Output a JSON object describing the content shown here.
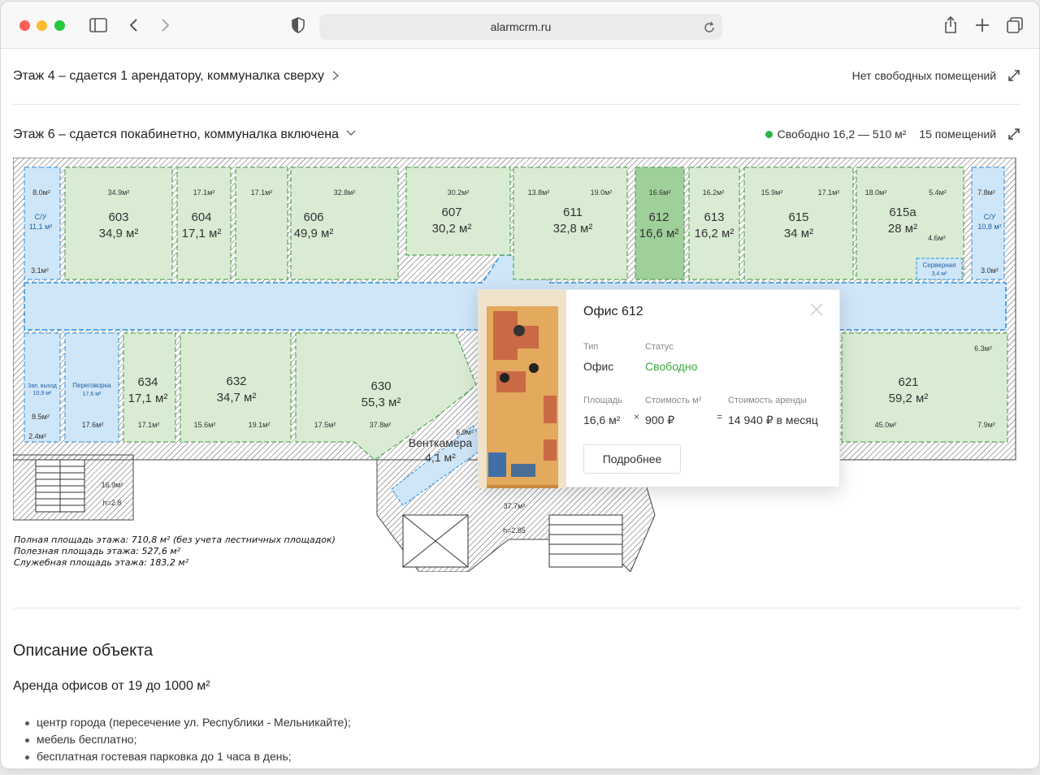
{
  "browser": {
    "url": "alarmcrm.ru"
  },
  "floors": [
    {
      "label": "Этаж 4 – сдается 1 арендатору, коммуналка сверху",
      "availability": "Нет свободных помещений"
    },
    {
      "label": "Этаж 6 – сдается покабинетно, коммуналка включена",
      "availability": "Свободно 16,2 — 510 м²",
      "count": "15 помещений"
    }
  ],
  "plan": {
    "rooms": [
      {
        "num": "603",
        "area": "34,9 м²",
        "small": "34.9м²"
      },
      {
        "num": "604",
        "area": "17,1 м²",
        "small": "17.1м²"
      },
      {
        "num": "606",
        "area": "49,9 м²",
        "small": "32.8м²"
      },
      {
        "num": "607",
        "area": "30,2 м²",
        "small": "30.2м²"
      },
      {
        "num": "611",
        "area": "32,8 м²",
        "small": "19.0м²"
      },
      {
        "num": "612",
        "area": "16,6 м²",
        "small": "16.6м²"
      },
      {
        "num": "613",
        "area": "16,2 м²",
        "small": "16.2м²"
      },
      {
        "num": "615",
        "area": "34 м²",
        "small": "17.1м²"
      },
      {
        "num": "615а",
        "area": "28 м²",
        "small": "18.0м²"
      },
      {
        "num": "634",
        "area": "17,1 м²",
        "small": "17.1м²"
      },
      {
        "num": "632",
        "area": "34,7 м²",
        "small": "19.1м²"
      },
      {
        "num": "630",
        "area": "55,3 м²",
        "small": "37.8м²"
      },
      {
        "num": "621",
        "area": "59,2 м²",
        "small": "45.0м²"
      }
    ],
    "extra_small_labels": [
      "8.0м²",
      "17.1м²",
      "13.8м²",
      "15.9м²",
      "5.4м²",
      "4.6м²",
      "7.8м²",
      "3.1м²",
      "3.0м²",
      "8.5м²",
      "2.4м²",
      "17.6м²",
      "15.6м²",
      "17.5м²",
      "6.9м²",
      "6.3м²",
      "7.9м²",
      "16.9м²",
      "h=2.8",
      "37.7м²",
      "h=2.85"
    ],
    "service_rooms": {
      "wc_left": "С/У",
      "wc_left_area": "11,1 м²",
      "wc_right": "С/У",
      "wc_right_area": "10,8 м²",
      "server": "Серверная",
      "server_area": "3,4 м²",
      "meeting": "Переговорка",
      "meeting_area": "17,6 м²",
      "exit": "Зап. выход",
      "exit_area": "10,9 м²",
      "vent": "Венткамера",
      "vent_area": "4,1 м²"
    },
    "totals": [
      "Полная площадь этажа: 710,8 м² (без учета лестничных площадок)",
      "Полезная площадь этажа: 527,6 м²",
      "Служебная площадь этажа: 183,2 м²"
    ]
  },
  "popup": {
    "title": "Офис 612",
    "type_label": "Тип",
    "type_value": "Офис",
    "status_label": "Статус",
    "status_value": "Свободно",
    "area_label": "Площадь",
    "area_value": "16,6 м²",
    "price_label": "Стоимость м²",
    "price_value": "900 ₽",
    "rent_label": "Стоимость аренды",
    "rent_value": "14 940 ₽ в месяц",
    "multiply": "×",
    "equals": "=",
    "more_button": "Подробнее"
  },
  "description": {
    "title": "Описание объекта",
    "subtitle": "Аренда офисов от 19 до 1000 м²",
    "bullets": [
      "центр города (пересечение ул. Республики - Мельникайте);",
      "мебель бесплатно;",
      "бесплатная гостевая парковка до 1 часа в день;"
    ]
  },
  "colors": {
    "office_fill": "#d9ecd3",
    "office_stroke": "#3d9a3d",
    "selected_fill": "#9fd09a",
    "corridor_fill": "#cfe6f8",
    "corridor_stroke": "#2f8ee0",
    "status_green": "#3aa83a"
  },
  "icons": [
    "sidebar-icon",
    "back-icon",
    "forward-icon",
    "shield-icon",
    "reload-icon",
    "share-icon",
    "plus-icon",
    "tabs-icon",
    "chevron-right-icon",
    "chevron-down-icon",
    "expand-icon",
    "close-icon"
  ]
}
